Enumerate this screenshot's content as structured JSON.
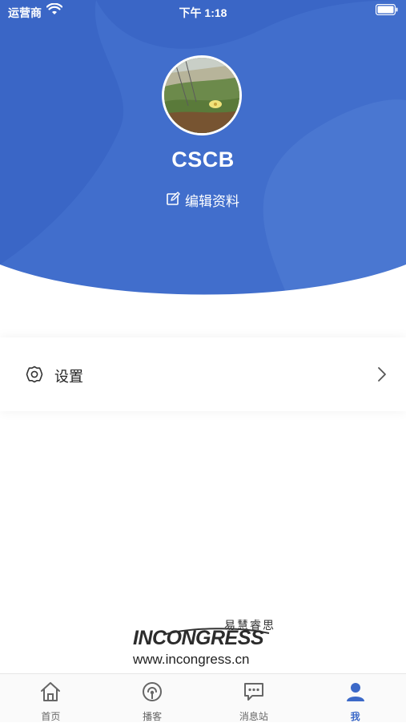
{
  "status_bar": {
    "carrier": "运营商",
    "time": "下午 1:18"
  },
  "profile": {
    "username": "CSCB",
    "edit_label": "编辑资料"
  },
  "menu": {
    "settings_label": "设置"
  },
  "logo": {
    "brand": "INCONGRESS",
    "tagline_cn": "易慧睿思",
    "url": "www.incongress.cn"
  },
  "tabs": [
    {
      "label": "首页",
      "icon": "home-icon",
      "active": false
    },
    {
      "label": "播客",
      "icon": "podcast-icon",
      "active": false
    },
    {
      "label": "消息站",
      "icon": "message-icon",
      "active": false
    },
    {
      "label": "我",
      "icon": "user-icon",
      "active": true
    }
  ],
  "colors": {
    "header_blue": "#3c69c8",
    "accent": "#3c69c8"
  }
}
